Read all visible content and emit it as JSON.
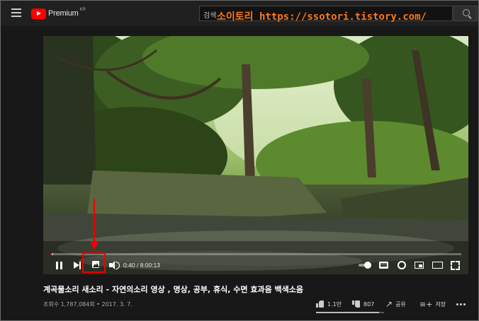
{
  "header": {
    "logo_text": "Premium",
    "logo_country": "KR",
    "search_placeholder": "검색",
    "watermark": "소이토리 https://ssotori.tistory.com/"
  },
  "player": {
    "time_display": "0:40 / 8:00:13",
    "progress_played_fraction": 0.0014,
    "progress_loaded_fraction": 0.004
  },
  "video": {
    "title": "계곡물소리 새소리 - 자연의소리 영상 , 명상, 공부, 휴식, 수면 효과음 백색소음",
    "meta": "조회수 1,787,084회 • 2017. 3. 7.",
    "likes": "1.1만",
    "dislikes": "807",
    "share_label": "공유",
    "save_label": "저장",
    "like_ratio": 0.93
  },
  "colors": {
    "accent": "#ff0000",
    "watermark": "#ff7a1a",
    "annotation": "#e00000"
  }
}
